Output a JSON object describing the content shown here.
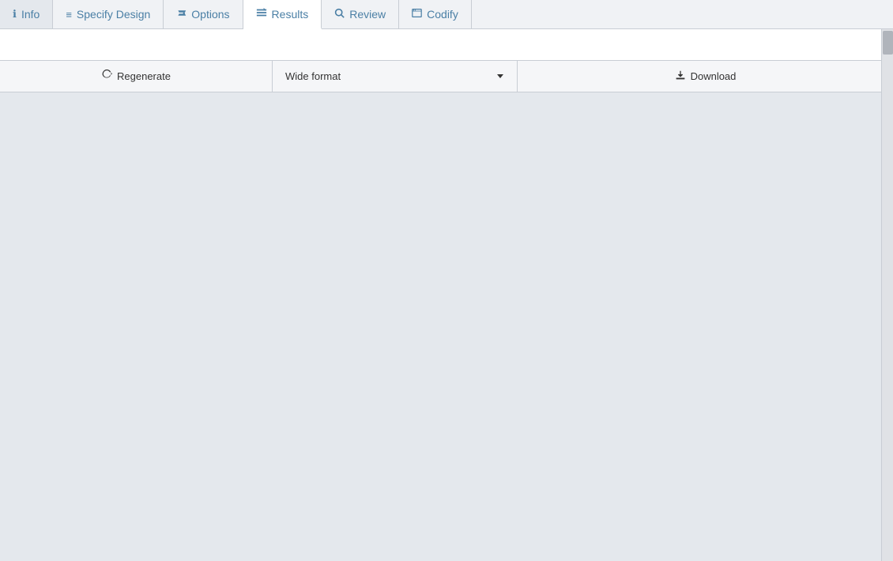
{
  "tabs": [
    {
      "id": "info",
      "label": "Info",
      "icon": "ℹ",
      "active": false
    },
    {
      "id": "specify-design",
      "label": "Specify Design",
      "icon": "≡",
      "active": false
    },
    {
      "id": "options",
      "label": "Options",
      "icon": "🔧",
      "active": false
    },
    {
      "id": "results",
      "label": "Results",
      "icon": "⇅",
      "active": true
    },
    {
      "id": "review",
      "label": "Review",
      "icon": "🔍",
      "active": false
    },
    {
      "id": "codify",
      "label": "Codify",
      "icon": "🖥",
      "active": false
    }
  ],
  "toolbar": {
    "regenerate_label": "Regenerate",
    "format_label": "Wide format",
    "download_label": "Download"
  }
}
